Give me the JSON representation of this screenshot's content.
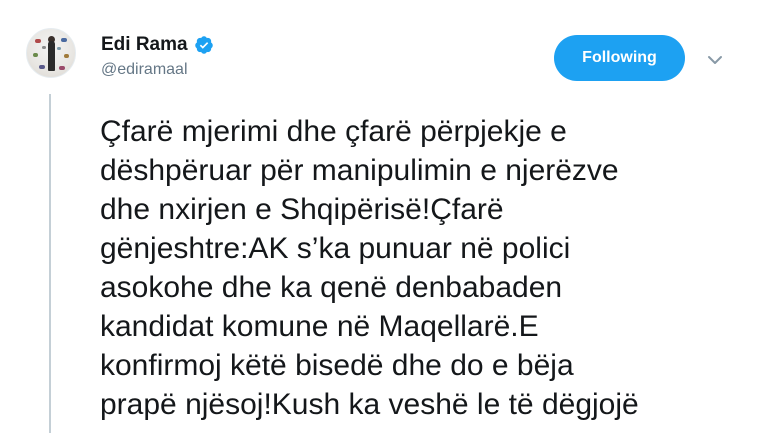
{
  "author": {
    "display_name": "Edi Rama",
    "handle": "@ediramaal",
    "verified": true
  },
  "follow_button": {
    "label": "Following"
  },
  "icons": {
    "verified": "verified-badge-icon",
    "menu": "chevron-down-icon"
  },
  "colors": {
    "accent": "#1da1f2",
    "handle": "#657786",
    "text": "#14171a",
    "thread_line": "#c4cfd6"
  },
  "tweet": {
    "text": "Çfarë mjerimi dhe çfarë përpjekje e\ndëshpëruar për manipulimin e njerëzve\ndhe nxirjen e Shqipërisë!Çfarë\ngënjeshtre:AK s’ka punuar në polici\nasokohe dhe ka qenë denbabaden\nkandidat komune në Maqellarë.E\nkonfirmoj këtë bisedë dhe do e bëja\nprapë njësoj!Kush ka veshë le të dëgjojë"
  }
}
